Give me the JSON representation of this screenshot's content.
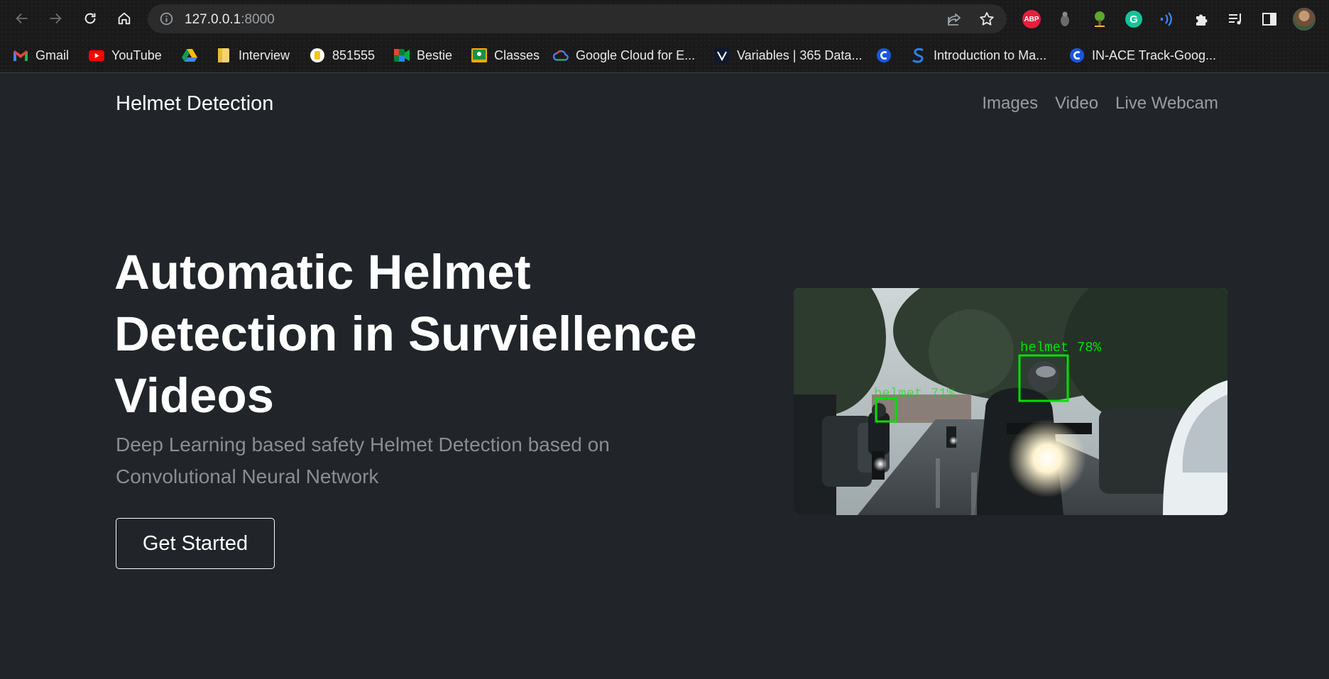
{
  "browser": {
    "url_host": "127.0.0.1",
    "url_port": ":8000",
    "extensions": {
      "abp_label": "ABP",
      "grammarly_label": "G"
    },
    "bookmarks": [
      {
        "label": "Gmail",
        "icon": "gmail-icon"
      },
      {
        "label": "YouTube",
        "icon": "youtube-icon"
      },
      {
        "label": "",
        "icon": "google-drive-icon"
      },
      {
        "label": "Interview",
        "icon": "folder-icon"
      },
      {
        "label": "851555",
        "icon": "site-icon"
      },
      {
        "label": "Bestie",
        "icon": "meet-icon"
      },
      {
        "label": "Classes",
        "icon": "classroom-icon"
      },
      {
        "label": "Google Cloud for E...",
        "icon": "google-cloud-icon"
      },
      {
        "label": "Variables | 365 Data...",
        "icon": "365-data-icon"
      },
      {
        "label": "",
        "icon": "c-site-icon"
      },
      {
        "label": "Introduction to Ma...",
        "icon": "s-site-icon"
      },
      {
        "label": "IN-ACE Track-Goog...",
        "icon": "c-site-icon"
      }
    ]
  },
  "navbar": {
    "brand": "Helmet Detection",
    "links": [
      "Images",
      "Video",
      "Live Webcam"
    ]
  },
  "hero": {
    "title": "Automatic Helmet Detection in Surviellence Videos",
    "subtitle": "Deep Learning based safety Helmet Detection based on Convolutional Neural Network",
    "cta_label": "Get Started",
    "image": {
      "detections": [
        {
          "label": "helmet 78%"
        },
        {
          "label": "helmet 71%"
        }
      ],
      "box_color": "#00e000"
    }
  },
  "colors": {
    "page_bg": "#212529",
    "chrome_bg": "#1a1a1a",
    "muted_text": "#8a8e93"
  }
}
